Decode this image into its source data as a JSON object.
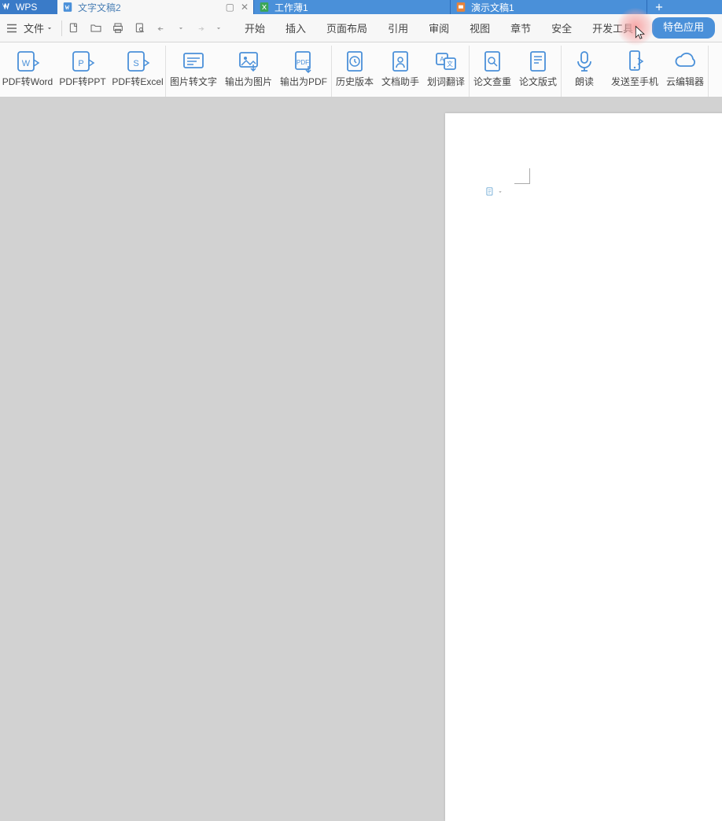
{
  "app_name": "WPS",
  "tabs": [
    {
      "label": "文字文稿2",
      "type": "doc",
      "color": "#4a90d9",
      "active": true
    },
    {
      "label": "工作薄1",
      "type": "sheet",
      "color": "#3aa655",
      "active": false
    },
    {
      "label": "演示文稿1",
      "type": "slide",
      "color": "#e8833a",
      "active": false
    }
  ],
  "menu": {
    "file_label": "文件",
    "items": [
      "开始",
      "插入",
      "页面布局",
      "引用",
      "审阅",
      "视图",
      "章节",
      "安全",
      "开发工具",
      "特色应用"
    ]
  },
  "ribbon": [
    {
      "group": "convert",
      "buttons": [
        "PDF转Word",
        "PDF转PPT",
        "PDF转Excel"
      ]
    },
    {
      "group": "image",
      "buttons": [
        "图片转文字",
        "输出为图片",
        "输出为PDF"
      ]
    },
    {
      "group": "doc",
      "buttons": [
        "历史版本",
        "文档助手",
        "划词翻译"
      ]
    },
    {
      "group": "thesis",
      "buttons": [
        "论文查重",
        "论文版式"
      ]
    },
    {
      "group": "share",
      "buttons": [
        "朗读",
        "发送至手机",
        "云编辑器"
      ]
    }
  ]
}
